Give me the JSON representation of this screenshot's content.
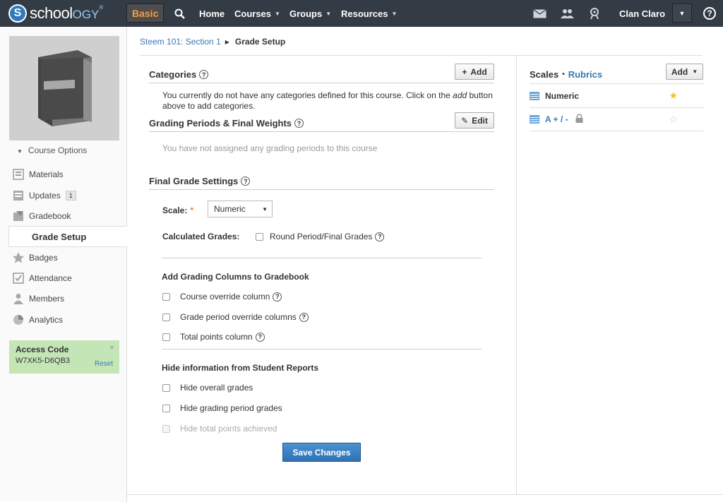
{
  "topbar": {
    "logo_letter": "S",
    "logo_prefix": "school",
    "logo_suffix": "OGY",
    "logo_mark": "®",
    "basic_label": "Basic",
    "nav": {
      "home": "Home",
      "courses": "Courses",
      "groups": "Groups",
      "resources": "Resources"
    },
    "user_name": "Clan Claro",
    "help_label": "?",
    "colors": {
      "bar": "#333b44",
      "basic_text": "#f39c4b"
    }
  },
  "sidebar": {
    "course_options_label": "Course Options",
    "items": [
      {
        "label": "Materials",
        "icon": "materials-icon"
      },
      {
        "label": "Updates",
        "icon": "updates-icon",
        "badge": "1"
      },
      {
        "label": "Gradebook",
        "icon": "gradebook-icon"
      },
      {
        "label": "Grade Setup",
        "active": true
      },
      {
        "label": "Badges",
        "icon": "badge-icon"
      },
      {
        "label": "Attendance",
        "icon": "attendance-icon"
      },
      {
        "label": "Members",
        "icon": "members-icon"
      },
      {
        "label": "Analytics",
        "icon": "analytics-icon"
      }
    ],
    "access": {
      "title": "Access Code",
      "code": "W7XK5-D6QB3",
      "reset": "Reset",
      "close": "×",
      "color": "#c4e6b6"
    }
  },
  "breadcrumb": {
    "parent": "Steem 101: Section 1",
    "current": "Grade Setup"
  },
  "categories": {
    "title": "Categories",
    "add_label": "Add",
    "text_before": "You currently do not have any categories defined for this course. Click on the ",
    "text_em": "add",
    "text_after": " button",
    "text_line2": "above to add categories."
  },
  "grading_periods": {
    "title": "Grading Periods & Final Weights",
    "edit_label": "Edit",
    "empty_text": "You have not assigned any grading periods to this course"
  },
  "final_grade": {
    "title": "Final Grade Settings",
    "scale_label": "Scale:",
    "scale_required": "*",
    "scale_value": "Numeric",
    "calculated_label": "Calculated Grades:",
    "round_label": "Round Period/Final Grades",
    "columns_title": "Add Grading Columns to Gradebook",
    "columns": [
      "Course override column",
      "Grade period override columns",
      "Total points column"
    ],
    "hide_title": "Hide information from Student Reports",
    "hide_options": [
      "Hide overall grades",
      "Hide grading period grades",
      "Hide total points achieved"
    ],
    "save_label": "Save Changes",
    "save_color": "#2d72b5"
  },
  "scales": {
    "title": "Scales",
    "separator": "•",
    "rubrics_label": "Rubrics",
    "add_label": "Add",
    "items": [
      {
        "label": "Numeric",
        "default": true
      },
      {
        "label": "A + / -",
        "locked": true,
        "default": false
      }
    ],
    "link_color": "#3679b6"
  }
}
